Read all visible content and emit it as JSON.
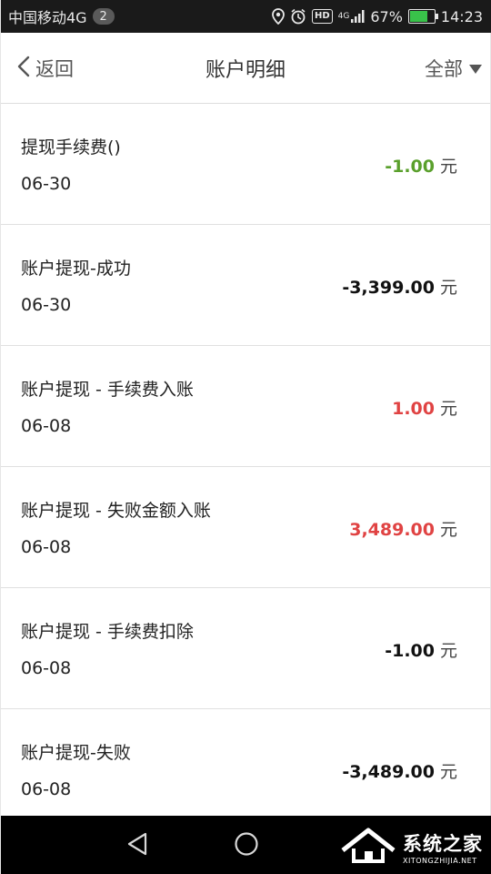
{
  "status_bar": {
    "carrier": "中国移动4G",
    "notif_count": "2",
    "hd": "HD",
    "net": "4G",
    "battery": "67%",
    "battery_fraction": 0.67,
    "time": "14:23"
  },
  "header": {
    "back_label": "返回",
    "title": "账户明细",
    "filter_label": "全部"
  },
  "transactions": [
    {
      "title": "提现手续费()",
      "date": "06-30",
      "amount": "-1.00",
      "unit": "元",
      "color": "#5aa02c"
    },
    {
      "title": "账户提现-成功",
      "date": "06-30",
      "amount": "-3,399.00",
      "unit": "元",
      "color": "#111111"
    },
    {
      "title": "账户提现 - 手续费入账",
      "date": "06-08",
      "amount": "1.00",
      "unit": "元",
      "color": "#e04343"
    },
    {
      "title": "账户提现 - 失败金额入账",
      "date": "06-08",
      "amount": "3,489.00",
      "unit": "元",
      "color": "#e04343"
    },
    {
      "title": "账户提现 - 手续费扣除",
      "date": "06-08",
      "amount": "-1.00",
      "unit": "元",
      "color": "#111111"
    },
    {
      "title": "账户提现-失败",
      "date": "06-08",
      "amount": "-3,489.00",
      "unit": "元",
      "color": "#111111"
    }
  ],
  "watermark": {
    "main": "系统之家",
    "sub": "XITONGZHIJIA.NET"
  }
}
